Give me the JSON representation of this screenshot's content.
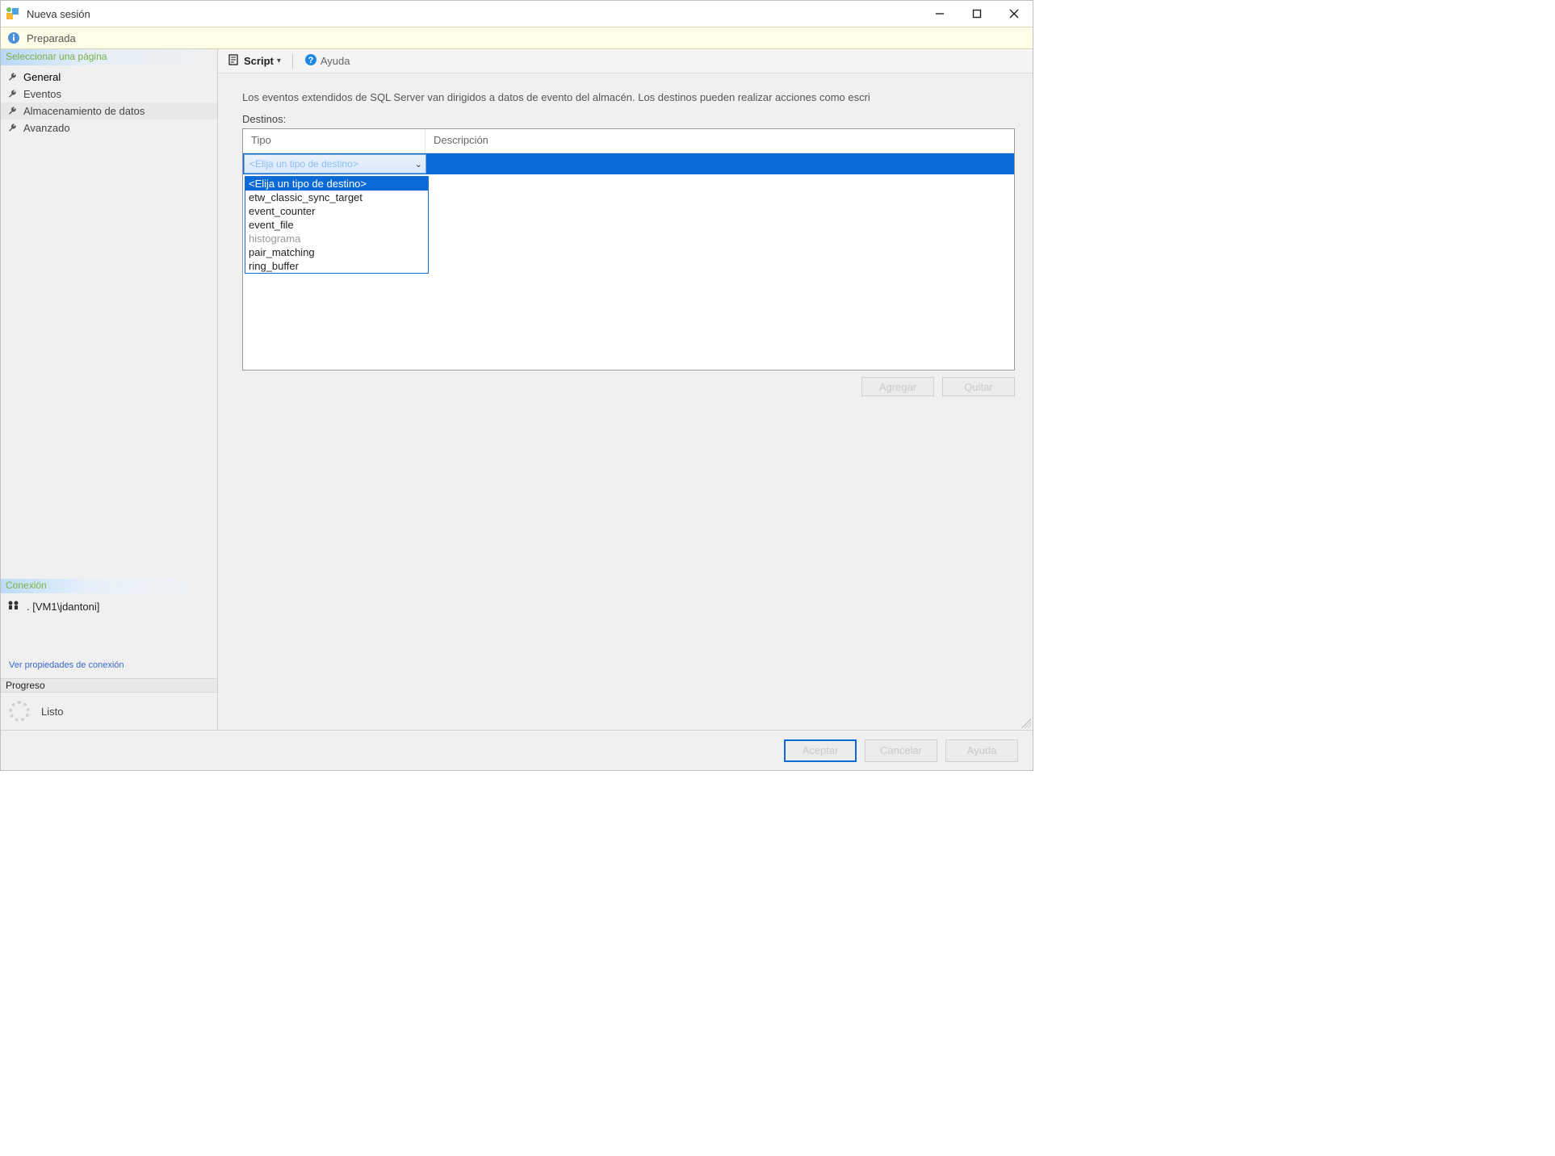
{
  "window": {
    "title": "Nueva sesión"
  },
  "status": {
    "text": "Preparada"
  },
  "sidebar": {
    "header": "Seleccionar una página",
    "items": [
      {
        "label": "General"
      },
      {
        "label": "Eventos"
      },
      {
        "label": "Almacenamiento de datos"
      },
      {
        "label": "Avanzado"
      }
    ],
    "connection": {
      "header": "Conexión",
      "server": ". [VM1\\jdantoni]",
      "link": "Ver propiedades de conexión"
    },
    "progress": {
      "header": "Progreso",
      "status": "Listo"
    }
  },
  "toolbar": {
    "script_label": "Script",
    "help_label": "Ayuda"
  },
  "main": {
    "intro": "Los eventos extendidos de SQL Server van dirigidos a datos de evento del almacén. Los destinos pueden realizar acciones como escri",
    "destinos_label": "Destinos:",
    "columns": {
      "tipo": "Tipo",
      "desc": "Descripción"
    },
    "combo_placeholder": "<Elija un tipo de destino>",
    "dropdown_options": [
      {
        "label": "<Elija un tipo de destino>",
        "selected": true
      },
      {
        "label": "etw_classic_sync_target"
      },
      {
        "label": "event_counter"
      },
      {
        "label": "event_file"
      },
      {
        "label": "histograma",
        "disabled": true
      },
      {
        "label": "pair_matching"
      },
      {
        "label": "ring_buffer"
      }
    ],
    "buttons": {
      "add": "Agregar",
      "remove": "Quitar"
    }
  },
  "footer": {
    "ok": "Aceptar",
    "cancel": "Cancelar",
    "help": "Ayuda"
  }
}
